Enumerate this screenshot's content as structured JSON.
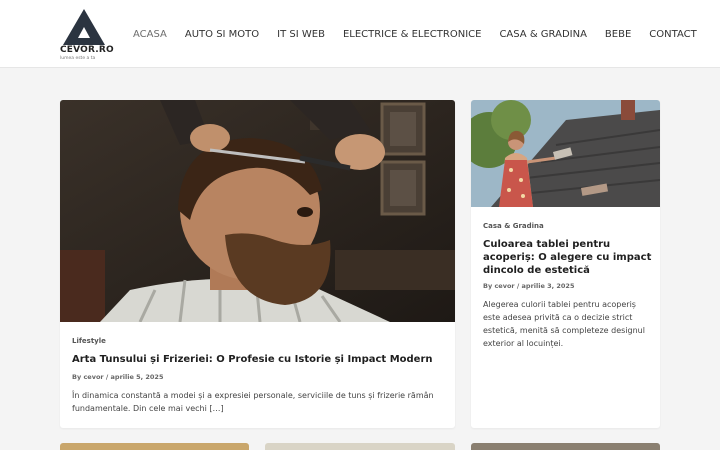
{
  "brand": {
    "name": "CEVOR.RO",
    "tagline": "lumea este a ta"
  },
  "nav": {
    "items": [
      {
        "label": "ACASA",
        "active": true
      },
      {
        "label": "AUTO SI MOTO",
        "active": false
      },
      {
        "label": "IT SI WEB",
        "active": false
      },
      {
        "label": "ELECTRICE & ELECTRONICE",
        "active": false
      },
      {
        "label": "CASA & GRADINA",
        "active": false
      },
      {
        "label": "BEBE",
        "active": false
      },
      {
        "label": "CONTACT",
        "active": false
      }
    ]
  },
  "featured": {
    "category": "Lifestyle",
    "title": "Arta Tunsului și Frizeriei: O Profesie cu Istorie și Impact Modern",
    "meta": "By cevor / aprilie 5, 2025",
    "excerpt": "În dinamica constantă a modei și a expresiei personale, serviciile de tuns și frizerie rămân fundamentale. Din cele mai vechi […]",
    "image_icon": "barber-photo"
  },
  "side": {
    "category": "Casa & Gradina",
    "title": "Culoarea tablei pentru acoperiș: O alegere cu impact dincolo de estetică",
    "meta": "By cevor / aprilie 3, 2025",
    "excerpt": "Alegerea culorii tablei pentru acoperiș este adesea privită ca o decizie strict estetică, menită să completeze designul exterior al locuinței.",
    "image_icon": "roof-photo"
  },
  "colors": {
    "background": "#f4f4f4",
    "header": "#ffffff",
    "text": "#1f1f1f",
    "muted": "#666666"
  }
}
